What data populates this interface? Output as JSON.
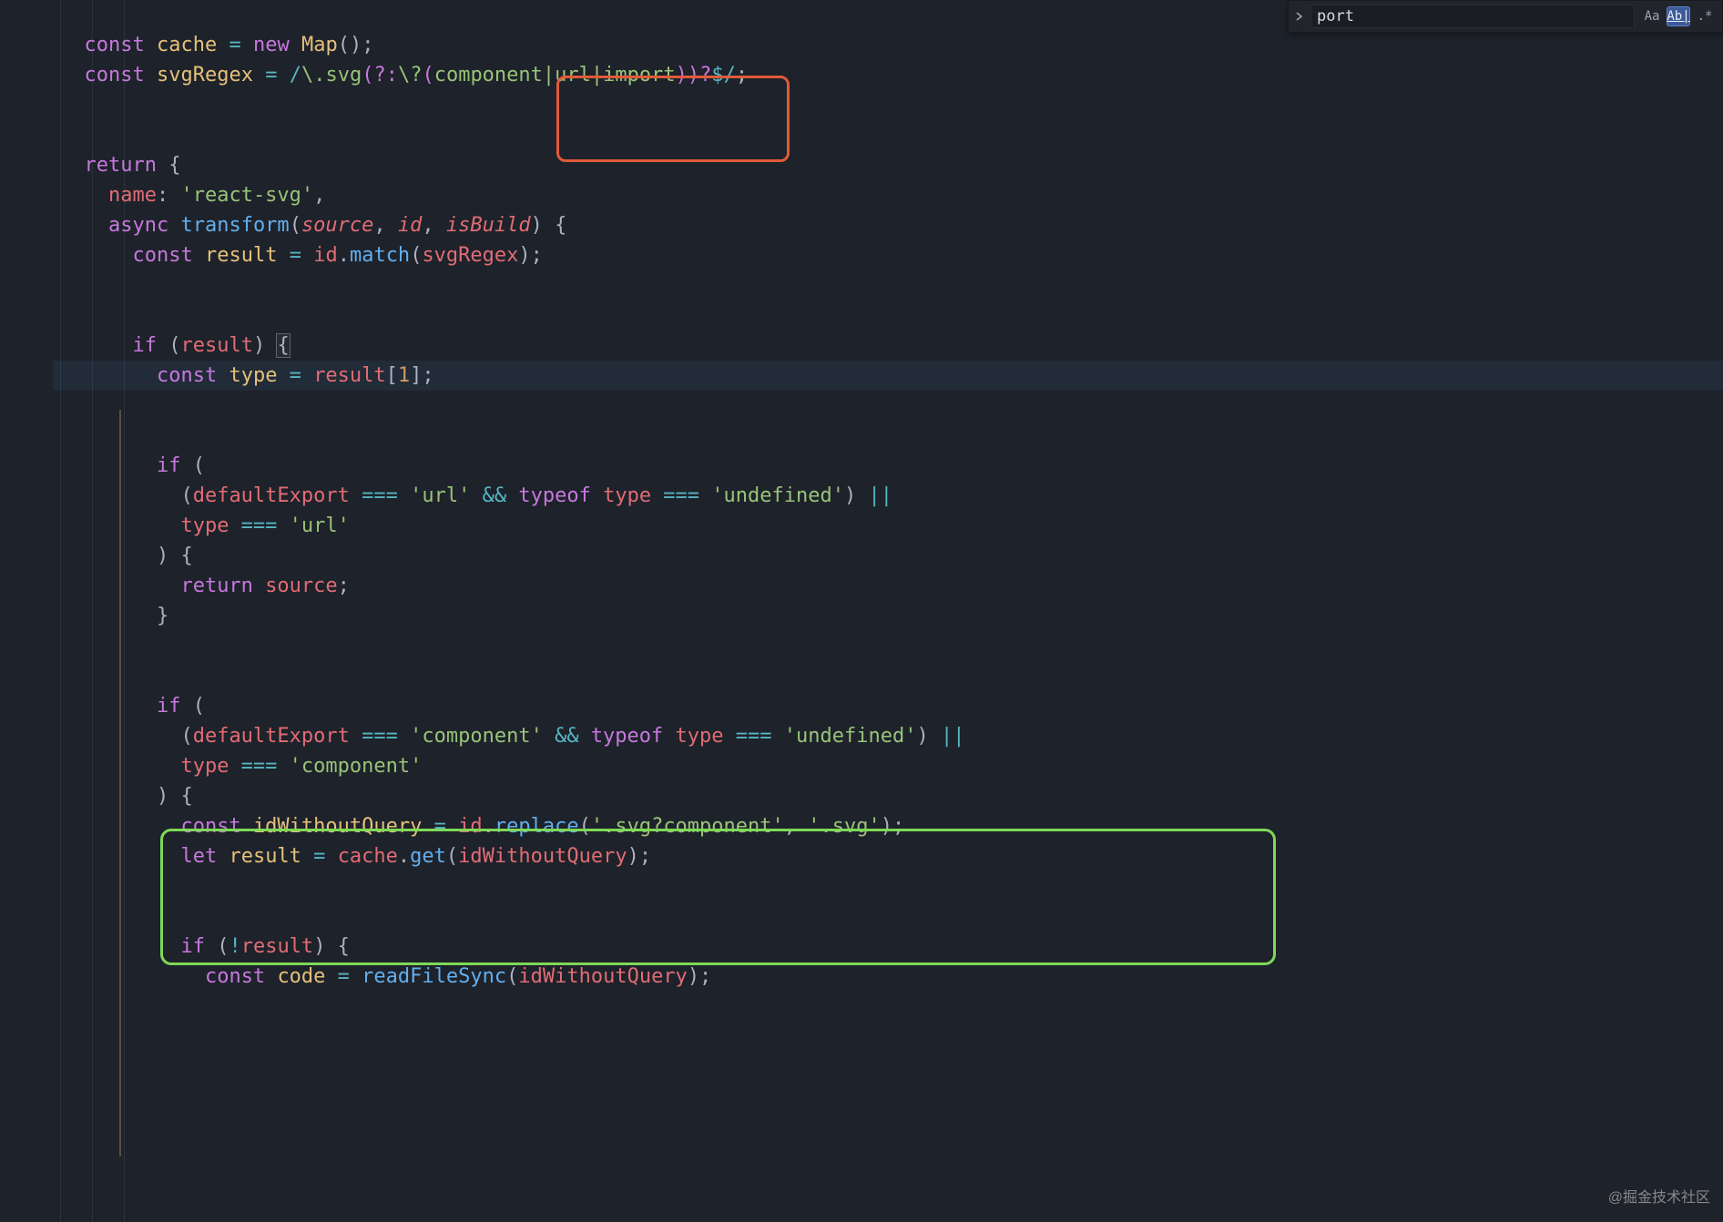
{
  "search": {
    "value": "port",
    "options": {
      "case_label": "Aa",
      "word_label": "Ab|",
      "regex_label": ".*"
    }
  },
  "watermark": "@掘金技术社区",
  "code": {
    "l2": {
      "const": "const",
      "cache": "cache",
      "eq": " = ",
      "new": "new",
      "map": "Map",
      "endp": "();"
    },
    "l3": {
      "const": "const",
      "svgRegex": "svgRegex",
      "eq": " = ",
      "rd1": "/",
      "rb": "\\.",
      "svg": "svg",
      "g1o": "(",
      "ncg": "?:",
      "esc": "\\?",
      "g2o": "(",
      "alt": "component|url|import",
      "g2c": ")",
      "g1c": ")",
      "q": "?",
      "anch": "$",
      "rd2": "/",
      "semi": ";"
    },
    "l5": {
      "return": "return",
      "brace": " {"
    },
    "l6": {
      "name": "name",
      "colon": ": ",
      "str": "'react-svg'",
      "comma": ","
    },
    "l7": {
      "async": "async",
      "transform": "transform",
      "open": "(",
      "p1": "source",
      "c1": ", ",
      "p2": "id",
      "c2": ", ",
      "p3": "isBuild",
      "close": ") {"
    },
    "l8": {
      "const": "const",
      "result": "result",
      "eq": " = ",
      "id": "id",
      "dot": ".",
      "match": "match",
      "open": "(",
      "arg": "svgRegex",
      "close": ");"
    },
    "l10": {
      "if": "if",
      "open": " (",
      "result": "result",
      "close": ") ",
      "brace": "{"
    },
    "l11": {
      "const": "const",
      "type": "type",
      "eq": " = ",
      "result": "result",
      "open": "[",
      "idx": "1",
      "close": "];"
    },
    "l13": {
      "if": "if",
      "open": " ("
    },
    "l14": {
      "open": "(",
      "de": "defaultExport",
      "eqeq": " === ",
      "s1": "'url'",
      "and": " && ",
      "typeof": "typeof",
      "sp": " ",
      "type": "type",
      "eqeq2": " === ",
      "s2": "'undefined'",
      "close": ") ",
      "or": "||"
    },
    "l15": {
      "type": "type",
      "eqeq": " === ",
      "s1": "'url'"
    },
    "l16": {
      "close": ") {"
    },
    "l17": {
      "return": "return",
      "sp": " ",
      "source": "source",
      "semi": ";"
    },
    "l18": {
      "brace": "}"
    },
    "l20": {
      "if": "if",
      "open": " ("
    },
    "l21": {
      "open": "(",
      "de": "defaultExport",
      "eqeq": " === ",
      "s1": "'component'",
      "and": " && ",
      "typeof": "typeof",
      "sp": " ",
      "type": "type",
      "eqeq2": " === ",
      "s2": "'undefined'",
      "close": ") ",
      "or": "||"
    },
    "l22": {
      "type": "type",
      "eqeq": " === ",
      "s1": "'component'"
    },
    "l23": {
      "close": ") {"
    },
    "l24": {
      "const": "const",
      "idw": "idWithoutQuery",
      "eq": " = ",
      "id": "id",
      "dot": ".",
      "replace": "replace",
      "open": "(",
      "s1": "'.svg?component'",
      "comma": ", ",
      "s2": "'.svg'",
      "close": ");"
    },
    "l25": {
      "let": "let",
      "result": "result",
      "eq": " = ",
      "cache": "cache",
      "dot": ".",
      "get": "get",
      "open": "(",
      "arg": "idWithoutQuery",
      "close": ");"
    },
    "l27": {
      "if": "if",
      "open": " (",
      "not": "!",
      "result": "result",
      "close": ") {"
    },
    "l28": {
      "const": "const",
      "code": "code",
      "eq": " = ",
      "readFileSync": "readFileSync",
      "open": "(",
      "arg": "idWithoutQuery",
      "close": ");"
    }
  }
}
